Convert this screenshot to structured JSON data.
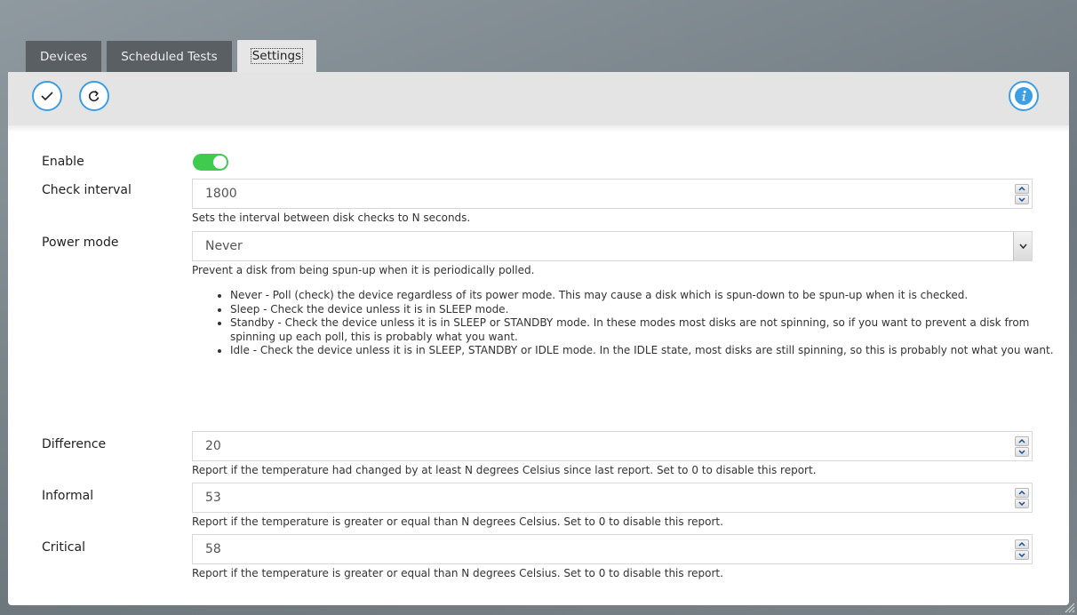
{
  "tabs": [
    {
      "label": "Devices"
    },
    {
      "label": "Scheduled Tests"
    },
    {
      "label": "Settings"
    }
  ],
  "toolbar": {
    "apply_icon": "check-icon",
    "reload_icon": "refresh-icon",
    "info_icon": "info-icon",
    "accent": "#3d9ee4"
  },
  "settings": {
    "enable": {
      "label": "Enable",
      "value": true,
      "color": "#3ecb4e"
    },
    "check_interval": {
      "label": "Check interval",
      "value": "1800",
      "help": "Sets the interval between disk checks to N seconds."
    },
    "power_mode": {
      "label": "Power mode",
      "value": "Never",
      "help": "Prevent a disk from being spun-up when it is periodically polled.",
      "options_help": [
        "Never - Poll (check) the device regardless of its power mode. This may cause a disk which is spun-down to be spun-up when it is checked.",
        "Sleep - Check the device unless it is in SLEEP mode.",
        "Standby - Check the device unless it is in SLEEP or STANDBY mode. In these modes most disks are not spinning, so if you want to prevent a disk from spinning up each poll, this is probably what you want.",
        "Idle - Check the device unless it is in SLEEP, STANDBY or IDLE mode. In the IDLE state, most disks are still spinning, so this is probably not what you want."
      ]
    },
    "difference": {
      "label": "Difference",
      "value": "20",
      "help": "Report if the temperature had changed by at least N degrees Celsius since last report. Set to 0 to disable this report."
    },
    "informal": {
      "label": "Informal",
      "value": "53",
      "help": "Report if the temperature is greater or equal than N degrees Celsius. Set to 0 to disable this report."
    },
    "critical": {
      "label": "Critical",
      "value": "58",
      "help": "Report if the temperature is greater or equal than N degrees Celsius. Set to 0 to disable this report."
    }
  }
}
